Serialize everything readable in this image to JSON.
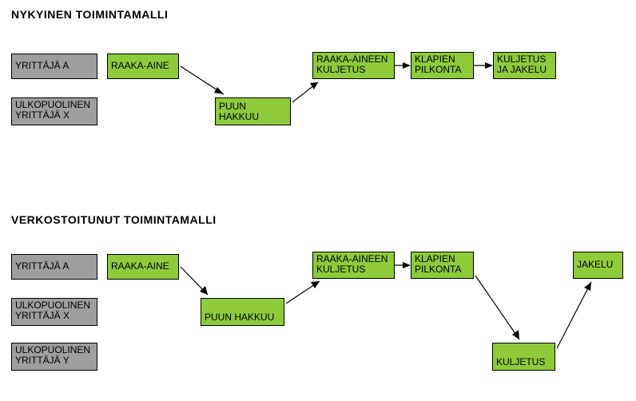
{
  "colors": {
    "process": "#8eca3a",
    "actor": "#9e9e9e"
  },
  "model_current": {
    "title": "NYKYINEN TOIMINTAMALLI",
    "actors": {
      "a": "YRITTÄJÄ A",
      "x_line1": "ULKOPUOLINEN",
      "x_line2": "YRITTÄJÄ X"
    },
    "steps": {
      "raaka_aine": "RAAKA-AINE",
      "puun_hakkuu": "PUUN HAKKUU",
      "raaka_kuljetus_line1": "RAAKA-AINEEN",
      "raaka_kuljetus_line2": "KULJETUS",
      "klapien_line1": "KLAPIEN",
      "klapien_line2": "PILKONTA",
      "kuljetus_jakelu_line1": "KULJETUS",
      "kuljetus_jakelu_line2": "JA JAKELU"
    }
  },
  "model_networked": {
    "title": "VERKOSTOITUNUT TOIMINTAMALLI",
    "actors": {
      "a": "YRITTÄJÄ A",
      "x_line1": "ULKOPUOLINEN",
      "x_line2": "YRITTÄJÄ X",
      "y_line1": "ULKOPUOLINEN",
      "y_line2": "YRITTÄJÄ Y"
    },
    "steps": {
      "raaka_aine": "RAAKA-AINE",
      "puun_hakkuu": "PUUN HAKKUU",
      "raaka_kuljetus_line1": "RAAKA-AINEEN",
      "raaka_kuljetus_line2": "KULJETUS",
      "klapien_line1": "KLAPIEN",
      "klapien_line2": "PILKONTA",
      "kuljetus": "KULJETUS",
      "jakelu": "JAKELU"
    }
  },
  "chart_data": [
    {
      "type": "flow",
      "title": "NYKYINEN TOIMINTAMALLI",
      "lanes": [
        "YRITTÄJÄ A",
        "ULKOPUOLINEN YRITTÄJÄ X"
      ],
      "nodes": [
        {
          "id": "raaka_aine",
          "label": "RAAKA-AINE",
          "lane": "YRITTÄJÄ A"
        },
        {
          "id": "puun_hakkuu",
          "label": "PUUN HAKKUU",
          "lane": "ULKOPUOLINEN YRITTÄJÄ X"
        },
        {
          "id": "raaka_kuljetus",
          "label": "RAAKA-AINEEN KULJETUS",
          "lane": "YRITTÄJÄ A"
        },
        {
          "id": "klapien_pilkonta",
          "label": "KLAPIEN PILKONTA",
          "lane": "YRITTÄJÄ A"
        },
        {
          "id": "kuljetus_jakelu",
          "label": "KULJETUS JA JAKELU",
          "lane": "YRITTÄJÄ A"
        }
      ],
      "edges": [
        [
          "raaka_aine",
          "puun_hakkuu"
        ],
        [
          "puun_hakkuu",
          "raaka_kuljetus"
        ],
        [
          "raaka_kuljetus",
          "klapien_pilkonta"
        ],
        [
          "klapien_pilkonta",
          "kuljetus_jakelu"
        ]
      ]
    },
    {
      "type": "flow",
      "title": "VERKOSTOITUNUT TOIMINTAMALLI",
      "lanes": [
        "YRITTÄJÄ A",
        "ULKOPUOLINEN YRITTÄJÄ X",
        "ULKOPUOLINEN YRITTÄJÄ Y"
      ],
      "nodes": [
        {
          "id": "raaka_aine",
          "label": "RAAKA-AINE",
          "lane": "YRITTÄJÄ A"
        },
        {
          "id": "puun_hakkuu",
          "label": "PUUN HAKKUU",
          "lane": "ULKOPUOLINEN YRITTÄJÄ X"
        },
        {
          "id": "raaka_kuljetus",
          "label": "RAAKA-AINEEN KULJETUS",
          "lane": "YRITTÄJÄ A"
        },
        {
          "id": "klapien_pilkonta",
          "label": "KLAPIEN PILKONTA",
          "lane": "YRITTÄJÄ A"
        },
        {
          "id": "kuljetus",
          "label": "KULJETUS",
          "lane": "ULKOPUOLINEN YRITTÄJÄ Y"
        },
        {
          "id": "jakelu",
          "label": "JAKELU",
          "lane": "YRITTÄJÄ A"
        }
      ],
      "edges": [
        [
          "raaka_aine",
          "puun_hakkuu"
        ],
        [
          "puun_hakkuu",
          "raaka_kuljetus"
        ],
        [
          "raaka_kuljetus",
          "klapien_pilkonta"
        ],
        [
          "klapien_pilkonta",
          "kuljetus"
        ],
        [
          "kuljetus",
          "jakelu"
        ]
      ]
    }
  ]
}
